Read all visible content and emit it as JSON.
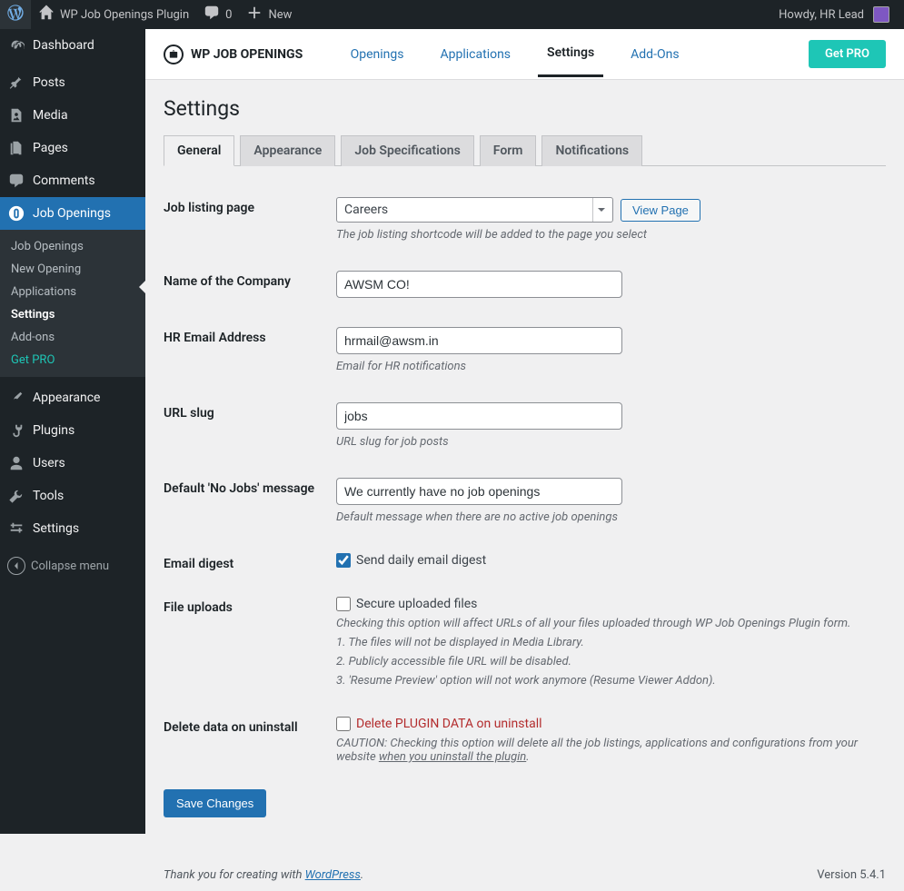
{
  "adminbar": {
    "site_title": "WP Job Openings Plugin",
    "comment_count": "0",
    "new_label": "New",
    "howdy": "Howdy, HR Lead"
  },
  "adminmenu": {
    "items": [
      {
        "label": "Dashboard"
      },
      {
        "label": "Posts"
      },
      {
        "label": "Media"
      },
      {
        "label": "Pages"
      },
      {
        "label": "Comments"
      },
      {
        "label": "Job Openings"
      },
      {
        "label": "Appearance"
      },
      {
        "label": "Plugins"
      },
      {
        "label": "Users"
      },
      {
        "label": "Tools"
      },
      {
        "label": "Settings"
      }
    ],
    "submenu": [
      {
        "label": "Job Openings"
      },
      {
        "label": "New Opening"
      },
      {
        "label": "Applications"
      },
      {
        "label": "Settings"
      },
      {
        "label": "Add-ons"
      },
      {
        "label": "Get PRO"
      }
    ],
    "collapse": "Collapse menu"
  },
  "plugin": {
    "brand": "WP JOB OPENINGS",
    "tabs": [
      {
        "label": "Openings"
      },
      {
        "label": "Applications"
      },
      {
        "label": "Settings"
      },
      {
        "label": "Add-Ons"
      }
    ],
    "getpro": "Get PRO"
  },
  "page": {
    "title": "Settings"
  },
  "navtabs": [
    {
      "label": "General"
    },
    {
      "label": "Appearance"
    },
    {
      "label": "Job Specifications"
    },
    {
      "label": "Form"
    },
    {
      "label": "Notifications"
    }
  ],
  "form": {
    "listing_page": {
      "label": "Job listing page",
      "value": "Careers",
      "view_btn": "View Page",
      "desc": "The job listing shortcode will be added to the page you select"
    },
    "company_name": {
      "label": "Name of the Company",
      "value": "AWSM CO!"
    },
    "hr_email": {
      "label": "HR Email Address",
      "value": "hrmail@awsm.in",
      "desc": "Email for HR notifications"
    },
    "url_slug": {
      "label": "URL slug",
      "value": "jobs",
      "desc": "URL slug for job posts"
    },
    "no_jobs": {
      "label": "Default 'No Jobs' message",
      "value": "We currently have no job openings",
      "desc": "Default message when there are no active job openings"
    },
    "email_digest": {
      "label": "Email digest",
      "checkbox_label": "Send daily email digest"
    },
    "file_uploads": {
      "label": "File uploads",
      "checkbox_label": "Secure uploaded files",
      "desc_intro": "Checking this option will affect URLs of all your files uploaded through WP Job Openings Plugin form.",
      "desc_1": "1. The files will not be displayed in Media Library.",
      "desc_2": "2. Publicly accessible file URL will be disabled.",
      "desc_3": "3. 'Resume Preview' option will not work anymore (Resume Viewer Addon)."
    },
    "delete_data": {
      "label": "Delete data on uninstall",
      "checkbox_label": "Delete PLUGIN DATA on uninstall",
      "desc_part1": "CAUTION: Checking this option will delete all the job listings, applications and configurations from your website ",
      "desc_uline": "when you uninstall the plugin",
      "desc_part2": "."
    },
    "submit": "Save Changes"
  },
  "footer": {
    "thanks_pre": "Thank you for creating with ",
    "thanks_link": "WordPress",
    "thanks_post": ".",
    "version": "Version 5.4.1"
  }
}
